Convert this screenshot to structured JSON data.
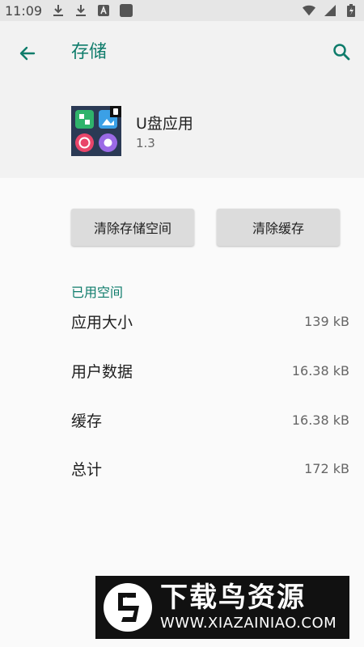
{
  "status_bar": {
    "time": "11:09",
    "icons": [
      "download-icon",
      "download-icon",
      "text-icon",
      "square-icon"
    ],
    "right_icons": [
      "wifi-icon",
      "signal-icon",
      "battery-icon"
    ]
  },
  "app_bar": {
    "title": "存储",
    "back_icon": "arrow-back-icon",
    "search_icon": "search-icon"
  },
  "app": {
    "name": "U盘应用",
    "version": "1.3"
  },
  "actions": {
    "clear_storage": "清除存储空间",
    "clear_cache": "清除缓存"
  },
  "section": {
    "label": "已用空间"
  },
  "rows": [
    {
      "label": "应用大小",
      "value": "139 kB"
    },
    {
      "label": "用户数据",
      "value": "16.38 kB"
    },
    {
      "label": "缓存",
      "value": "16.38 kB"
    },
    {
      "label": "总计",
      "value": "172 kB"
    }
  ],
  "watermark": {
    "cn": "下载鸟资源",
    "url": "WWW.XIAZAINIAO.COM"
  },
  "colors": {
    "accent": "#0e7c6b",
    "button_bg": "#dcdcdc"
  }
}
